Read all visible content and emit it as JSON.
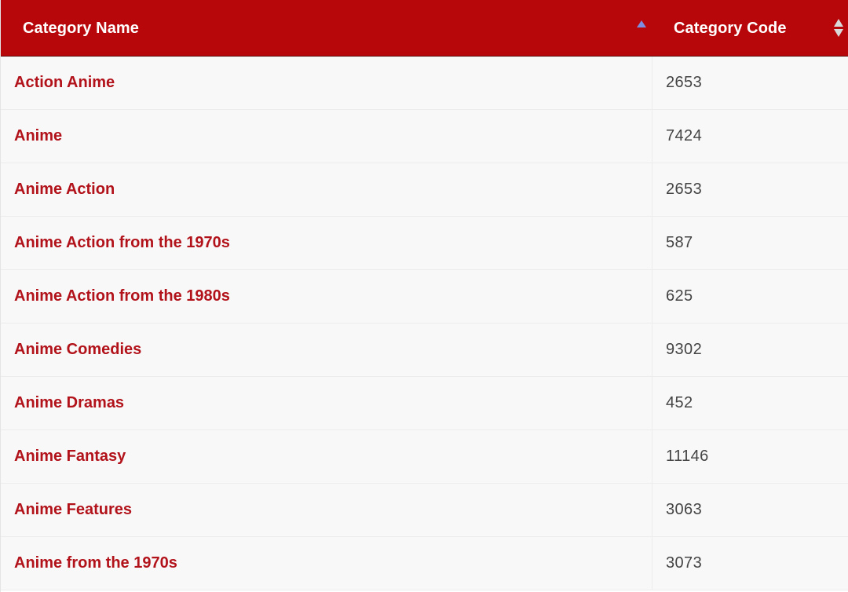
{
  "table": {
    "columns": [
      {
        "label": "Category Name",
        "sort": "ascending"
      },
      {
        "label": "Category Code",
        "sort": "none"
      }
    ],
    "rows": [
      {
        "name": "Action Anime",
        "code": "2653"
      },
      {
        "name": "Anime",
        "code": "7424"
      },
      {
        "name": "Anime Action",
        "code": "2653"
      },
      {
        "name": "Anime Action from the 1970s",
        "code": "587"
      },
      {
        "name": "Anime Action from the 1980s",
        "code": "625"
      },
      {
        "name": "Anime Comedies",
        "code": "9302"
      },
      {
        "name": "Anime Dramas",
        "code": "452"
      },
      {
        "name": "Anime Fantasy",
        "code": "11146"
      },
      {
        "name": "Anime Features",
        "code": "3063"
      },
      {
        "name": "Anime from the 1970s",
        "code": "3073"
      }
    ]
  },
  "colors": {
    "header_background": "#b8070b",
    "link_text": "#b2121a",
    "code_text": "#444444",
    "row_background": "#f8f8f8",
    "sort_active": "#7d8ee0",
    "sort_inactive": "#d9d9d9"
  },
  "icons": {
    "name_sort": "sort-ascending-icon",
    "code_sort": "sort-both-icon"
  }
}
